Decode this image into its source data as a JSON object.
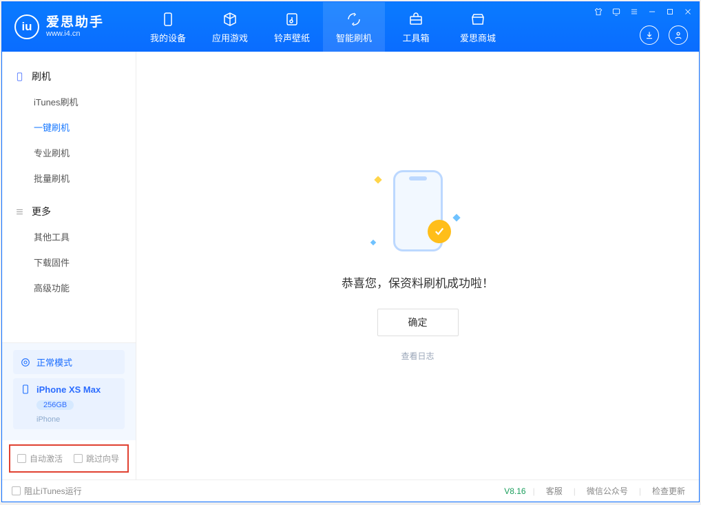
{
  "app": {
    "title": "爱思助手",
    "subtitle": "www.i4.cn"
  },
  "nav": {
    "items": [
      {
        "label": "我的设备",
        "icon": "device"
      },
      {
        "label": "应用游戏",
        "icon": "cube"
      },
      {
        "label": "铃声壁纸",
        "icon": "music"
      },
      {
        "label": "智能刷机",
        "icon": "refresh",
        "active": true
      },
      {
        "label": "工具箱",
        "icon": "toolbox"
      },
      {
        "label": "爱思商城",
        "icon": "shop"
      }
    ]
  },
  "sidebar": {
    "group_flash": {
      "title": "刷机",
      "items": [
        {
          "label": "iTunes刷机"
        },
        {
          "label": "一键刷机",
          "active": true
        },
        {
          "label": "专业刷机"
        },
        {
          "label": "批量刷机"
        }
      ]
    },
    "group_more": {
      "title": "更多",
      "items": [
        {
          "label": "其他工具"
        },
        {
          "label": "下载固件"
        },
        {
          "label": "高级功能"
        }
      ]
    },
    "mode": {
      "label": "正常模式"
    },
    "device": {
      "name": "iPhone XS Max",
      "storage": "256GB",
      "type": "iPhone"
    },
    "checks": {
      "auto_activate": "自动激活",
      "skip_guide": "跳过向导"
    }
  },
  "main": {
    "success_msg": "恭喜您，保资料刷机成功啦！",
    "ok": "确定",
    "view_log": "查看日志"
  },
  "footer": {
    "block_itunes": "阻止iTunes运行",
    "version": "V8.16",
    "links": {
      "support": "客服",
      "wechat": "微信公众号",
      "update": "检查更新"
    }
  }
}
